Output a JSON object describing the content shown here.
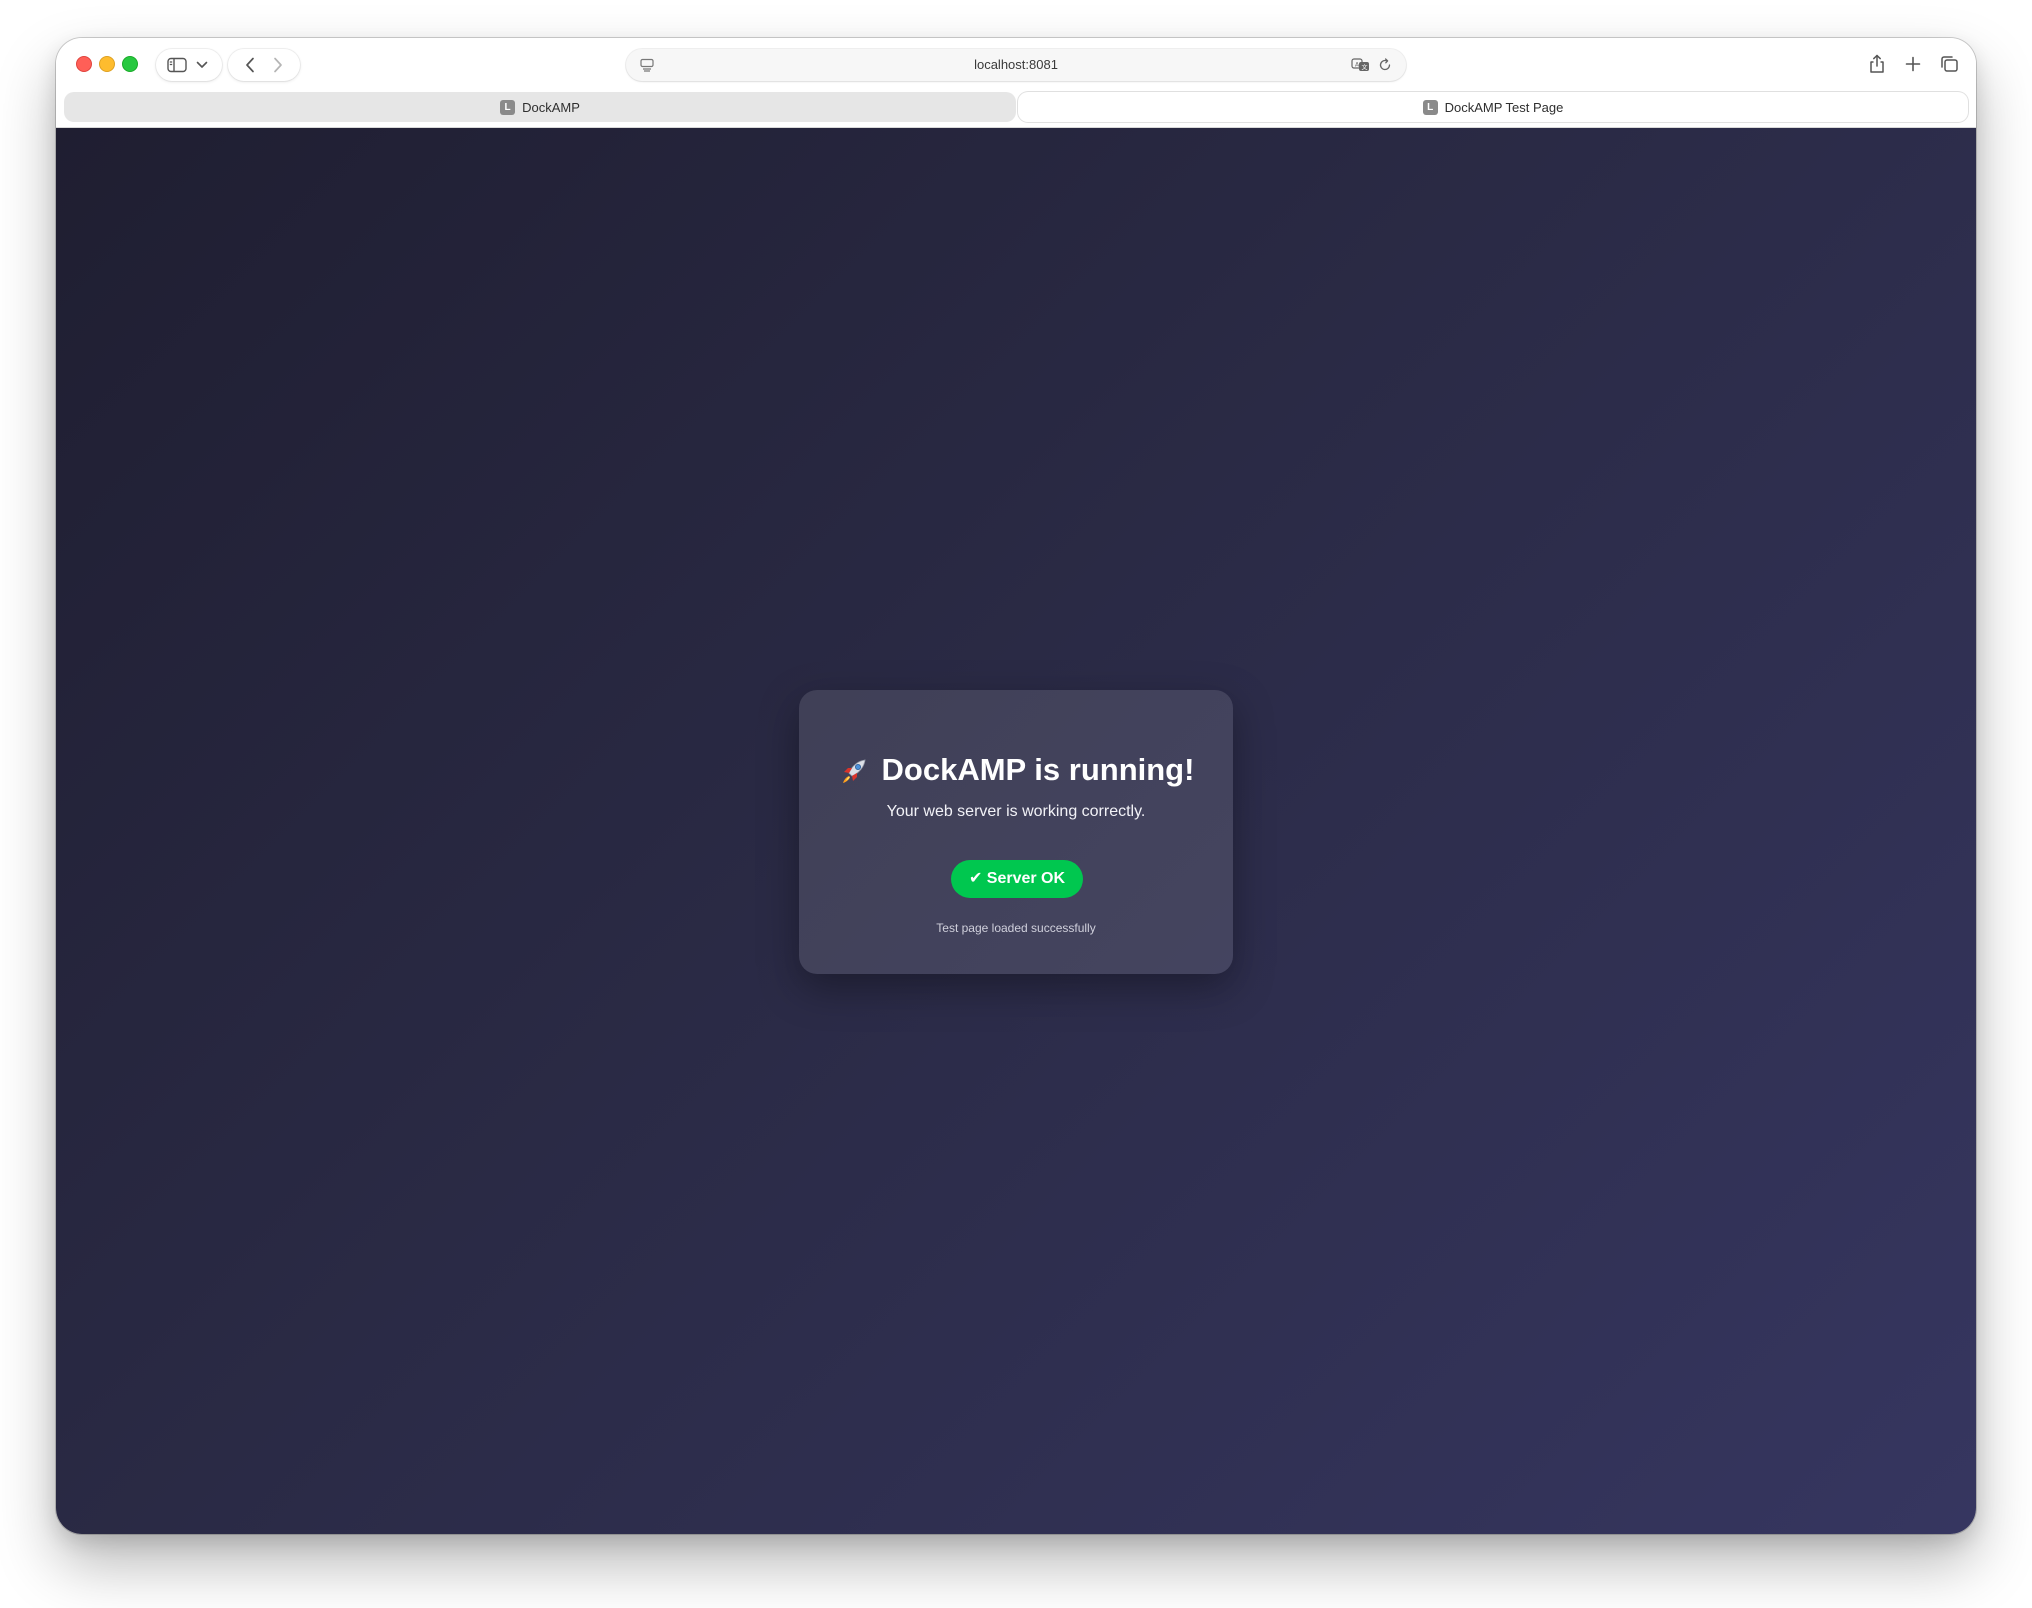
{
  "browser": {
    "url": "localhost:8081",
    "tabs": [
      {
        "label": "DockAMP",
        "favicon": "L",
        "active": false
      },
      {
        "label": "DockAMP Test Page",
        "favicon": "L",
        "active": true
      }
    ],
    "icons": {
      "sidebar": "sidebar-icon",
      "sidebar_menu": "chevron-down-icon",
      "back": "back-arrow-icon",
      "forward": "forward-arrow-icon",
      "page_menu": "page-menu-icon",
      "translate": "translate-icon",
      "reload": "reload-icon",
      "share": "share-icon",
      "new_tab": "plus-icon",
      "tab_overview": "tab-overview-icon"
    }
  },
  "page": {
    "title": "DockAMP is running!",
    "title_icon": "rocket-icon",
    "subtitle": "Your web server is working correctly.",
    "status_label": "✔ Server OK",
    "footnote": "Test page loaded successfully"
  },
  "colors": {
    "status_green": "#00c74f",
    "background_start": "#1f1e31",
    "background_end": "#363660"
  }
}
